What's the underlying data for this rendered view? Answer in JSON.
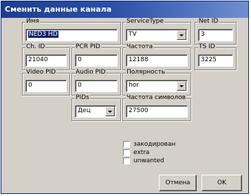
{
  "title": "Сменить данные канала",
  "fields": {
    "name": {
      "label": "Имя",
      "value": "NED3 HD"
    },
    "service_type": {
      "label": "ServiceType",
      "value": "TV"
    },
    "net_id": {
      "label": "Net ID",
      "value": "3"
    },
    "ch_id": {
      "label": "Ch. ID",
      "value": "21040"
    },
    "pcr_pid": {
      "label": "PCR PID",
      "value": "0"
    },
    "frequency": {
      "label": "Частота",
      "value": "12188"
    },
    "ts_id": {
      "label": "TS ID",
      "value": "3225"
    },
    "video_pid": {
      "label": "Video PID",
      "value": "0"
    },
    "audio_pid": {
      "label": "Audio PID",
      "value": "0"
    },
    "polarity": {
      "label": "Полярность",
      "value": "hor"
    },
    "pids": {
      "label": "PIDs",
      "value": "Дец"
    },
    "symbol_rate": {
      "label": "Частота символов",
      "value": "27500"
    }
  },
  "checkboxes": [
    {
      "label": "закодирован",
      "checked": false
    },
    {
      "label": "extra",
      "checked": false
    },
    {
      "label": "unwanted",
      "checked": false
    }
  ],
  "buttons": {
    "cancel": "Отмена",
    "ok": "OK"
  }
}
